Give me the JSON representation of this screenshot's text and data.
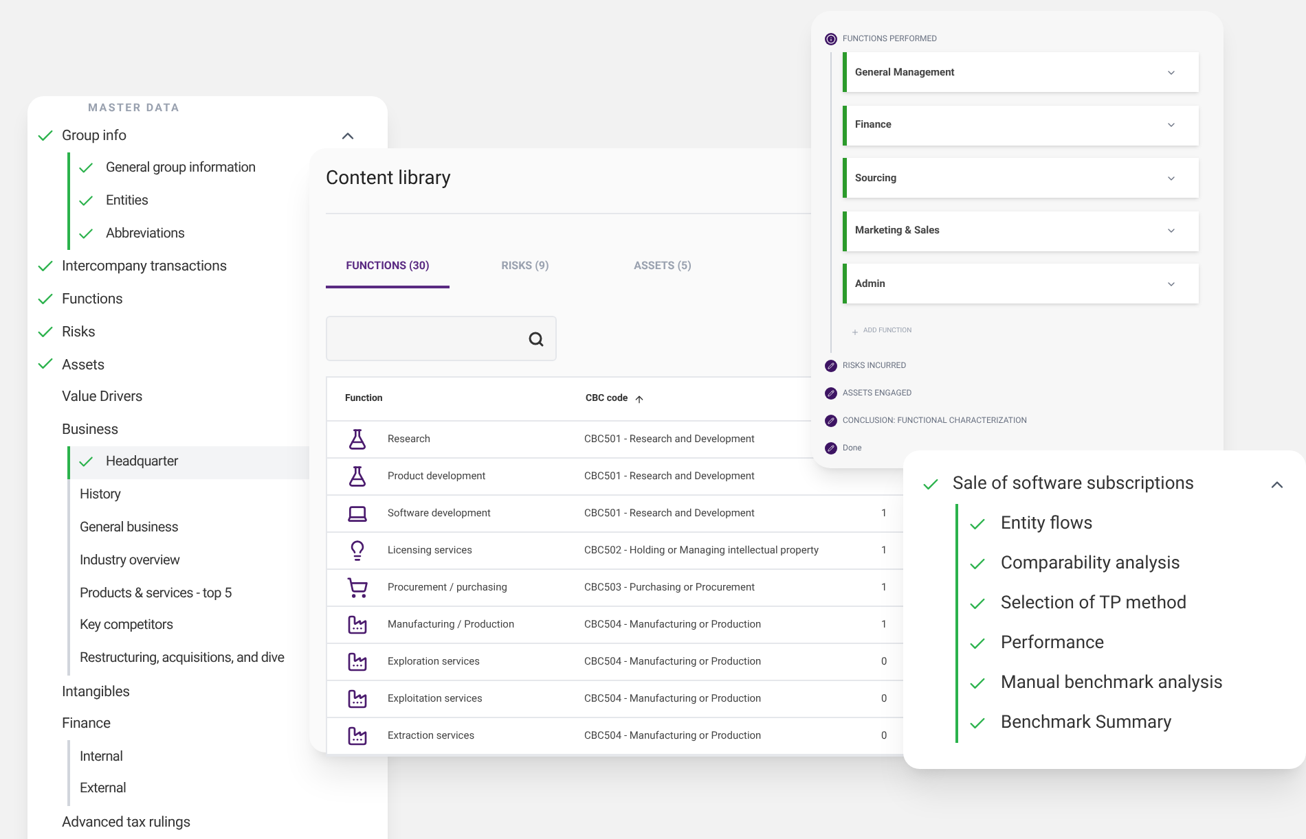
{
  "master_data": {
    "heading": "MASTER DATA",
    "items": [
      {
        "label": "Group info",
        "checked": true,
        "expanded": true,
        "selected": false,
        "children": [
          {
            "label": "General group information",
            "checked": true,
            "selected": false
          },
          {
            "label": "Entities",
            "checked": true,
            "selected": false
          },
          {
            "label": "Abbreviations",
            "checked": true,
            "selected": false
          }
        ]
      },
      {
        "label": "Intercompany transactions",
        "checked": true,
        "selected": false
      },
      {
        "label": "Functions",
        "checked": true,
        "selected": false
      },
      {
        "label": "Risks",
        "checked": true,
        "selected": false
      },
      {
        "label": "Assets",
        "checked": true,
        "selected": false
      },
      {
        "label": "Value Drivers",
        "checked": false,
        "selected": false
      },
      {
        "label": "Business",
        "checked": false,
        "selected": false,
        "children": [
          {
            "label": "Headquarter",
            "checked": true,
            "selected": true
          },
          {
            "label": "History",
            "checked": false,
            "selected": false
          },
          {
            "label": "General business",
            "checked": false,
            "selected": false
          },
          {
            "label": "Industry overview",
            "checked": false,
            "selected": false
          },
          {
            "label": "Products & services - top 5",
            "checked": false,
            "selected": false
          },
          {
            "label": "Key competitors",
            "checked": false,
            "selected": false
          },
          {
            "label": "Restructuring, acquisitions, and dive",
            "checked": false,
            "selected": false
          }
        ]
      },
      {
        "label": "Intangibles",
        "checked": false,
        "selected": false
      },
      {
        "label": "Finance",
        "checked": false,
        "selected": false,
        "children": [
          {
            "label": "Internal",
            "checked": false,
            "selected": false
          },
          {
            "label": "External",
            "checked": false,
            "selected": false
          }
        ]
      },
      {
        "label": "Advanced tax rulings",
        "checked": false,
        "selected": false
      }
    ]
  },
  "content_library": {
    "title": "Content library",
    "tabs": [
      {
        "label": "FUNCTIONS (30)",
        "selected": true
      },
      {
        "label": "RISKS (9)",
        "selected": false
      },
      {
        "label": "ASSETS (5)",
        "selected": false
      }
    ],
    "table": {
      "columns": [
        "Function",
        "CBC code"
      ],
      "rows": [
        {
          "kind": "flask",
          "function": "Research",
          "cbc_code": "CBC501 - Research and Development"
        },
        {
          "kind": "flask",
          "function": "Product development",
          "cbc_code": "CBC501 - Research and Development"
        },
        {
          "kind": "laptop",
          "function": "Software development",
          "cbc_code": "CBC501 - Research and Development",
          "column_3": "1"
        },
        {
          "kind": "bulb",
          "function": "Licensing services",
          "cbc_code": "CBC502 - Holding or Managing intellectual property",
          "column_3": "1"
        },
        {
          "kind": "cart",
          "function": "Procurement / purchasing",
          "cbc_code": "CBC503 - Purchasing or Procurement",
          "column_3": "1"
        },
        {
          "kind": "factory",
          "function": "Manufacturing / Production",
          "cbc_code": "CBC504 - Manufacturing or Production",
          "column_3": "1"
        },
        {
          "kind": "factory",
          "function": "Exploration services",
          "cbc_code": "CBC504 - Manufacturing or Production",
          "column_3": "0"
        },
        {
          "kind": "factory",
          "function": "Exploitation services",
          "cbc_code": "CBC504 - Manufacturing or Production",
          "column_3": "0"
        },
        {
          "kind": "factory",
          "function": "Extraction services",
          "cbc_code": "CBC504 - Manufacturing or Production",
          "column_3": "0"
        }
      ]
    }
  },
  "steps": [
    {
      "kind": "current",
      "label": "FUNCTIONS PERFORMED",
      "functions": [
        "General Management",
        "Finance",
        "Sourcing",
        "Marketing & Sales",
        "Admin"
      ],
      "add_label": "ADD FUNCTION"
    },
    {
      "kind": "done",
      "label": "RISKS INCURRED"
    },
    {
      "kind": "done",
      "label": "ASSETS ENGAGED"
    },
    {
      "kind": "done",
      "label": "CONCLUSION: FUNCTIONAL CHARACTERIZATION"
    },
    {
      "kind": "done",
      "label": "Done"
    }
  ],
  "transaction": {
    "label": "Sale of software subscriptions",
    "checked": true,
    "expanded": true,
    "children": [
      {
        "label": "Entity flows",
        "checked": true
      },
      {
        "label": "Comparability analysis",
        "checked": true
      },
      {
        "label": "Selection of TP method",
        "checked": true
      },
      {
        "label": "Performance",
        "checked": true
      },
      {
        "label": "Manual benchmark analysis",
        "checked": true
      },
      {
        "label": "Benchmark Summary",
        "checked": true
      }
    ]
  }
}
